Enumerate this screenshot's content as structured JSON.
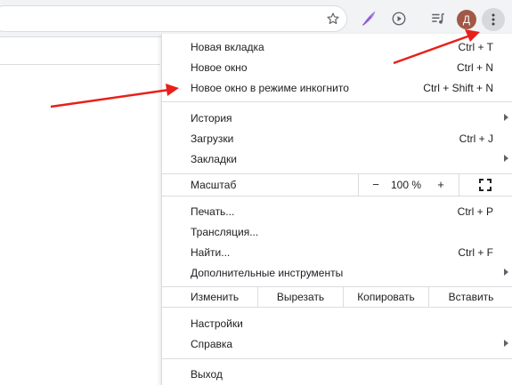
{
  "toolbar": {
    "icons": [
      "star-icon",
      "quill-extension-icon",
      "play-circle-icon",
      "playlist-icon",
      "kebab-menu-icon"
    ],
    "avatar_letter": "Д",
    "avatar_color": "#a15846"
  },
  "menu": {
    "new_tab": {
      "label": "Новая вкладка",
      "shortcut": "Ctrl + T"
    },
    "new_window": {
      "label": "Новое окно",
      "shortcut": "Ctrl + N"
    },
    "incognito": {
      "label": "Новое окно в режиме инкогнито",
      "shortcut": "Ctrl + Shift + N"
    },
    "history": {
      "label": "История"
    },
    "downloads": {
      "label": "Загрузки",
      "shortcut": "Ctrl + J"
    },
    "bookmarks": {
      "label": "Закладки"
    },
    "zoom": {
      "label": "Масштаб",
      "minus": "−",
      "value": "100 %",
      "plus": "+"
    },
    "print": {
      "label": "Печать...",
      "shortcut": "Ctrl + P"
    },
    "cast": {
      "label": "Трансляция..."
    },
    "find": {
      "label": "Найти...",
      "shortcut": "Ctrl + F"
    },
    "more_tools": {
      "label": "Дополнительные инструменты"
    },
    "edit": {
      "label": "Изменить",
      "cut": "Вырезать",
      "copy": "Копировать",
      "paste": "Вставить"
    },
    "settings": {
      "label": "Настройки"
    },
    "help": {
      "label": "Справка"
    },
    "exit": {
      "label": "Выход"
    }
  },
  "annotation_color": "#e8201a"
}
